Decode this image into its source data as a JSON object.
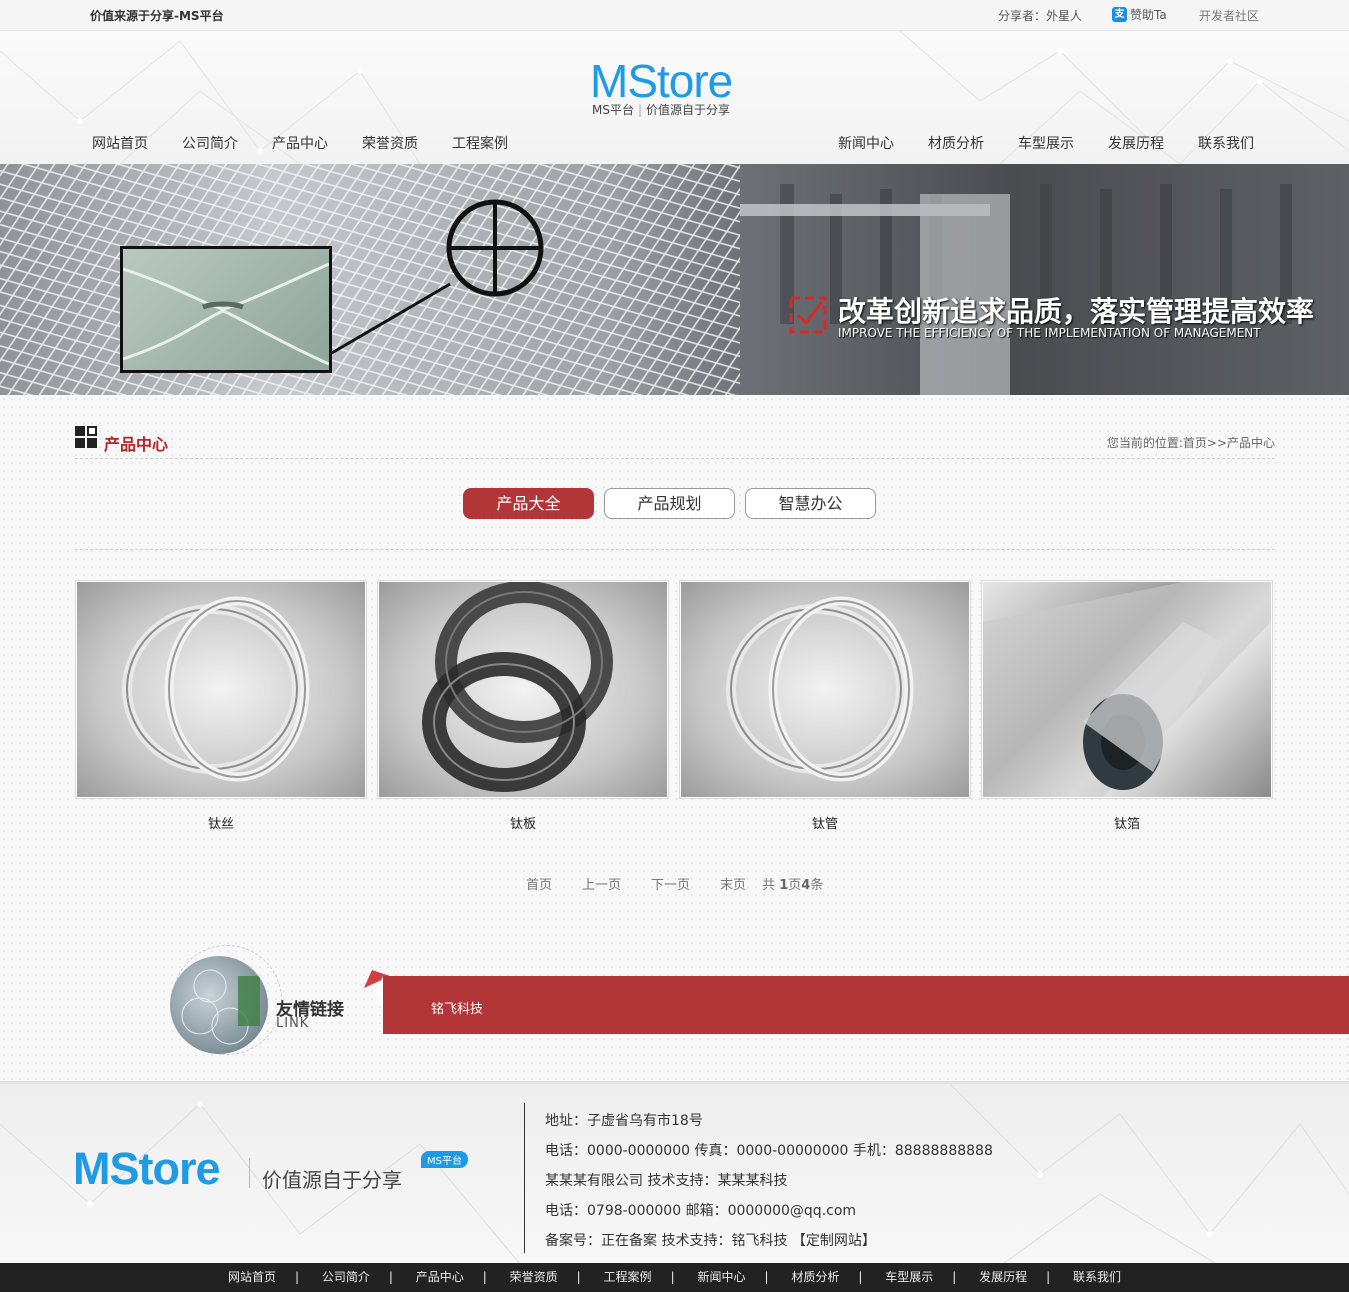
{
  "topbar": {
    "slogan": "价值来源于分享-MS平台",
    "sharer": "分享者：外星人",
    "donate": "赞助Ta",
    "dev": "开发者社区"
  },
  "header": {
    "logo": "MStore",
    "logo_sub_left": "MS平台",
    "logo_sub_right": "价值源自于分享",
    "nav_left": [
      "网站首页",
      "公司简介",
      "产品中心",
      "荣誉资质",
      "工程案例"
    ],
    "nav_right": [
      "新闻中心",
      "材质分析",
      "车型展示",
      "发展历程",
      "联系我们"
    ]
  },
  "banner": {
    "slogan_cn": "改革创新追求品质，落实管理提高效率",
    "slogan_en": "IMPROVE THE EFFICIENCY OF THE IMPLEMENTATION OF MANAGEMENT"
  },
  "section": {
    "title": "产品中心",
    "breadcrumb": "您当前的位置:首页>>产品中心"
  },
  "tabs": [
    {
      "label": "产品大全",
      "active": true
    },
    {
      "label": "产品规划",
      "active": false
    },
    {
      "label": "智慧办公",
      "active": false
    }
  ],
  "products": [
    {
      "name": "钛丝",
      "icon": "ring-icon"
    },
    {
      "name": "钛板",
      "icon": "coil-icon"
    },
    {
      "name": "钛管",
      "icon": "ring-icon"
    },
    {
      "name": "钛箔",
      "icon": "foil-roll-icon"
    }
  ],
  "pager": {
    "first": "首页",
    "prev": "上一页",
    "next": "下一页",
    "last": "末页",
    "total_prefix": "共 ",
    "pages": "1",
    "pages_unit": "页",
    "count": "4",
    "count_unit": "条"
  },
  "links": {
    "title": "友情链接",
    "subtitle": "LINK",
    "items": [
      "铭飞科技"
    ]
  },
  "footer": {
    "logo": "MStore",
    "tagline": "价值源自于分享",
    "badge": "MS平台",
    "info": [
      "地址：子虚省乌有市18号",
      "电话：0000-0000000 传真：0000-00000000 手机：88888888888",
      "某某某有限公司   技术支持：某某某科技",
      "电话：0798-000000 邮箱：0000000@qq.com",
      "备案号：正在备案     技术支持：铭飞科技  【定制网站】"
    ]
  },
  "bottom_nav": [
    "网站首页",
    "公司简介",
    "产品中心",
    "荣誉资质",
    "工程案例",
    "新闻中心",
    "材质分析",
    "车型展示",
    "发展历程",
    "联系我们"
  ],
  "colors": {
    "brand_blue": "#1f9be6",
    "accent_red": "#b23538",
    "bottom_bar": "#222222"
  }
}
